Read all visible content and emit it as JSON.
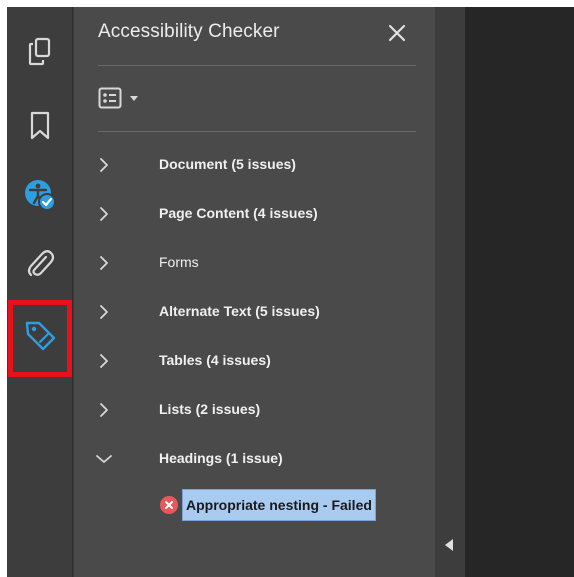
{
  "panel": {
    "title": "Accessibility Checker",
    "close_glyph": "✕"
  },
  "toolbar": {
    "items": [
      {
        "icon": "pages-icon"
      },
      {
        "icon": "bookmark-icon"
      },
      {
        "icon": "accessibility-icon",
        "active": true
      },
      {
        "icon": "attachment-icon"
      },
      {
        "icon": "tag-icon",
        "highlighted": true
      }
    ]
  },
  "categories": [
    {
      "label": "Document (5 issues)",
      "expanded": false,
      "bold": true
    },
    {
      "label": "Page Content (4 issues)",
      "expanded": false,
      "bold": true
    },
    {
      "label": "Forms",
      "expanded": false,
      "bold": false
    },
    {
      "label": "Alternate Text (5 issues)",
      "expanded": false,
      "bold": true
    },
    {
      "label": "Tables (4 issues)",
      "expanded": false,
      "bold": true
    },
    {
      "label": "Lists (2 issues)",
      "expanded": false,
      "bold": true
    },
    {
      "label": "Headings (1 issue)",
      "expanded": true,
      "bold": true
    }
  ],
  "selected_issue": {
    "label": "Appropriate nesting - Failed",
    "status": "failed"
  },
  "colors": {
    "accent": "#2d9ee0",
    "highlight_box": "#e8101b",
    "selection": "#a9cbf0",
    "error": "#e8585b"
  }
}
